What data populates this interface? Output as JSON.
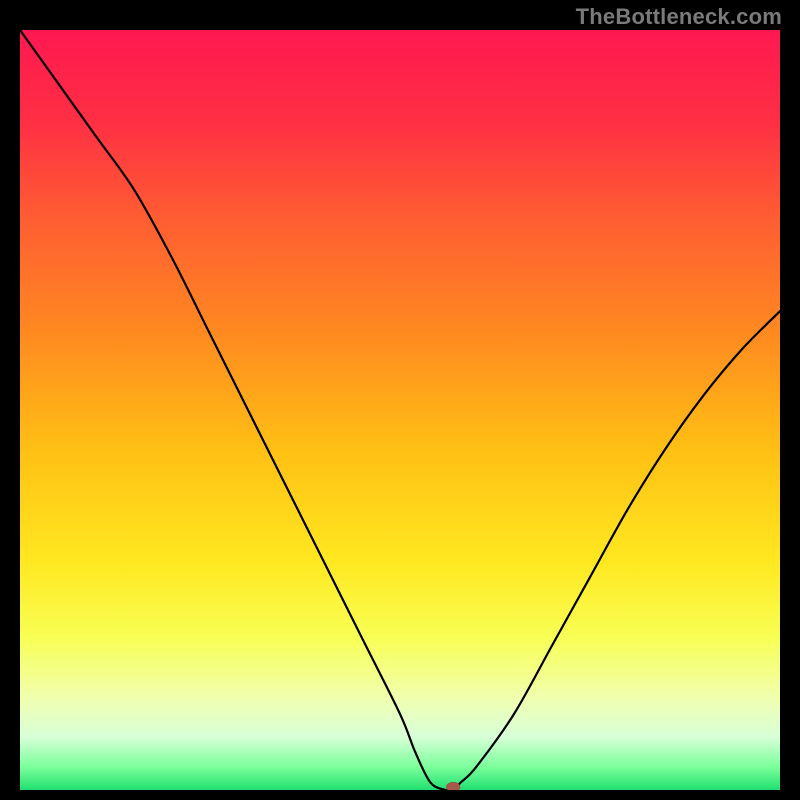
{
  "watermark": "TheBottleneck.com",
  "chart_data": {
    "type": "line",
    "title": "",
    "xlabel": "",
    "ylabel": "",
    "xlim": [
      0,
      100
    ],
    "ylim": [
      0,
      100
    ],
    "grid": false,
    "legend": false,
    "x": [
      0,
      5,
      10,
      15,
      20,
      25,
      30,
      35,
      40,
      45,
      50,
      52,
      54,
      56,
      57,
      58,
      60,
      65,
      70,
      75,
      80,
      85,
      90,
      95,
      100
    ],
    "values": [
      100,
      93,
      86,
      79,
      70,
      60,
      50,
      40,
      30,
      20,
      10,
      5,
      1,
      0,
      0,
      1,
      3,
      10,
      19,
      28,
      37,
      45,
      52,
      58,
      63
    ],
    "marker": {
      "x": 57,
      "y": 0
    },
    "gradient_stops": [
      {
        "offset": 0.0,
        "color": "#ff1850"
      },
      {
        "offset": 0.12,
        "color": "#ff2f44"
      },
      {
        "offset": 0.25,
        "color": "#ff5d32"
      },
      {
        "offset": 0.4,
        "color": "#ff8a20"
      },
      {
        "offset": 0.55,
        "color": "#ffbf14"
      },
      {
        "offset": 0.7,
        "color": "#ffe820"
      },
      {
        "offset": 0.8,
        "color": "#f8ff55"
      },
      {
        "offset": 0.88,
        "color": "#f0ffb0"
      },
      {
        "offset": 0.93,
        "color": "#d8ffd8"
      },
      {
        "offset": 0.97,
        "color": "#7aff9a"
      },
      {
        "offset": 1.0,
        "color": "#20e070"
      }
    ]
  }
}
